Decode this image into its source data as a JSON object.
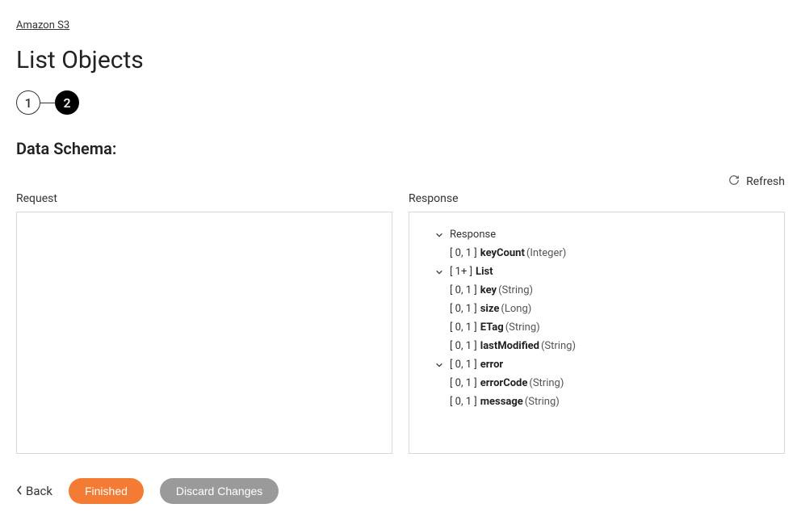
{
  "breadcrumb": "Amazon S3",
  "page_title": "List Objects",
  "stepper": {
    "step1": "1",
    "step2": "2"
  },
  "section_title": "Data Schema:",
  "refresh_label": "Refresh",
  "request_label": "Request",
  "response_label": "Response",
  "response_tree": {
    "root": "Response",
    "keyCount": {
      "card": "[ 0, 1 ]",
      "name": "keyCount",
      "type": "(Integer)"
    },
    "list": {
      "card": "[ 1+ ]",
      "name": "List"
    },
    "key": {
      "card": "[ 0, 1 ]",
      "name": "key",
      "type": "(String)"
    },
    "size": {
      "card": "[ 0, 1 ]",
      "name": "size",
      "type": "(Long)"
    },
    "etag": {
      "card": "[ 0, 1 ]",
      "name": "ETag",
      "type": "(String)"
    },
    "lastModified": {
      "card": "[ 0, 1 ]",
      "name": "lastModified",
      "type": "(String)"
    },
    "error": {
      "card": "[ 0, 1 ]",
      "name": "error"
    },
    "errorCode": {
      "card": "[ 0, 1 ]",
      "name": "errorCode",
      "type": "(String)"
    },
    "message": {
      "card": "[ 0, 1 ]",
      "name": "message",
      "type": "(String)"
    }
  },
  "footer": {
    "back": "Back",
    "finished": "Finished",
    "discard": "Discard Changes"
  }
}
